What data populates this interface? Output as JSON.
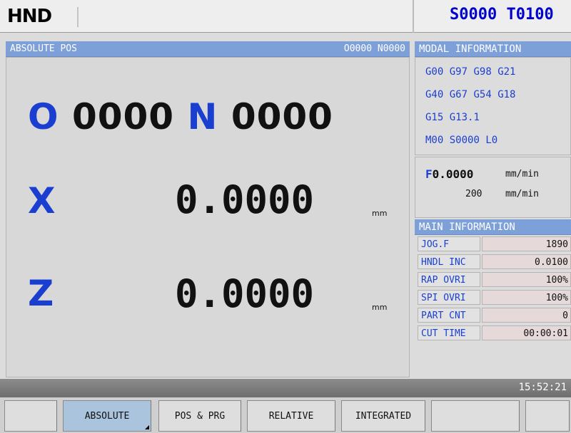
{
  "header": {
    "logo": "HND",
    "spindle": "S0000",
    "tool": "T0100"
  },
  "position": {
    "title": "ABSOLUTE POS",
    "program_block": "O0000 N0000",
    "o_label": "O",
    "o_value": "0000",
    "n_label": "N",
    "n_value": "0000",
    "axes": [
      {
        "name": "X",
        "value": "0.0000",
        "unit": "mm"
      },
      {
        "name": "Z",
        "value": "0.0000",
        "unit": "mm"
      }
    ]
  },
  "modal": {
    "title": "MODAL INFORMATION",
    "lines": [
      [
        "G00",
        "G97",
        "G98",
        "G21"
      ],
      [
        "G40",
        "G67",
        "G54",
        "G18"
      ],
      [
        "G15",
        "G13.1"
      ],
      [
        "M00",
        "S0000",
        "L0"
      ]
    ],
    "feed_label": "F",
    "feed_value": "0.0000",
    "feed_unit": "mm/min",
    "speed_value": "200",
    "speed_unit": "mm/min"
  },
  "main_info": {
    "title": "MAIN INFORMATION",
    "rows": [
      {
        "label": "JOG.F",
        "value": "1890"
      },
      {
        "label": "HNDL INC",
        "value": "0.0100"
      },
      {
        "label": "RAP OVRI",
        "value": "100%"
      },
      {
        "label": "SPI OVRI",
        "value": "100%"
      },
      {
        "label": "PART CNT",
        "value": "0"
      },
      {
        "label": "CUT TIME",
        "value": "00:00:01"
      }
    ]
  },
  "status": {
    "clock": "15:52:21"
  },
  "softkeys": [
    {
      "label": ""
    },
    {
      "label": "ABSOLUTE",
      "active": true
    },
    {
      "label": "POS & PRG"
    },
    {
      "label": "RELATIVE"
    },
    {
      "label": "INTEGRATED"
    },
    {
      "label": ""
    },
    {
      "label": ""
    }
  ]
}
